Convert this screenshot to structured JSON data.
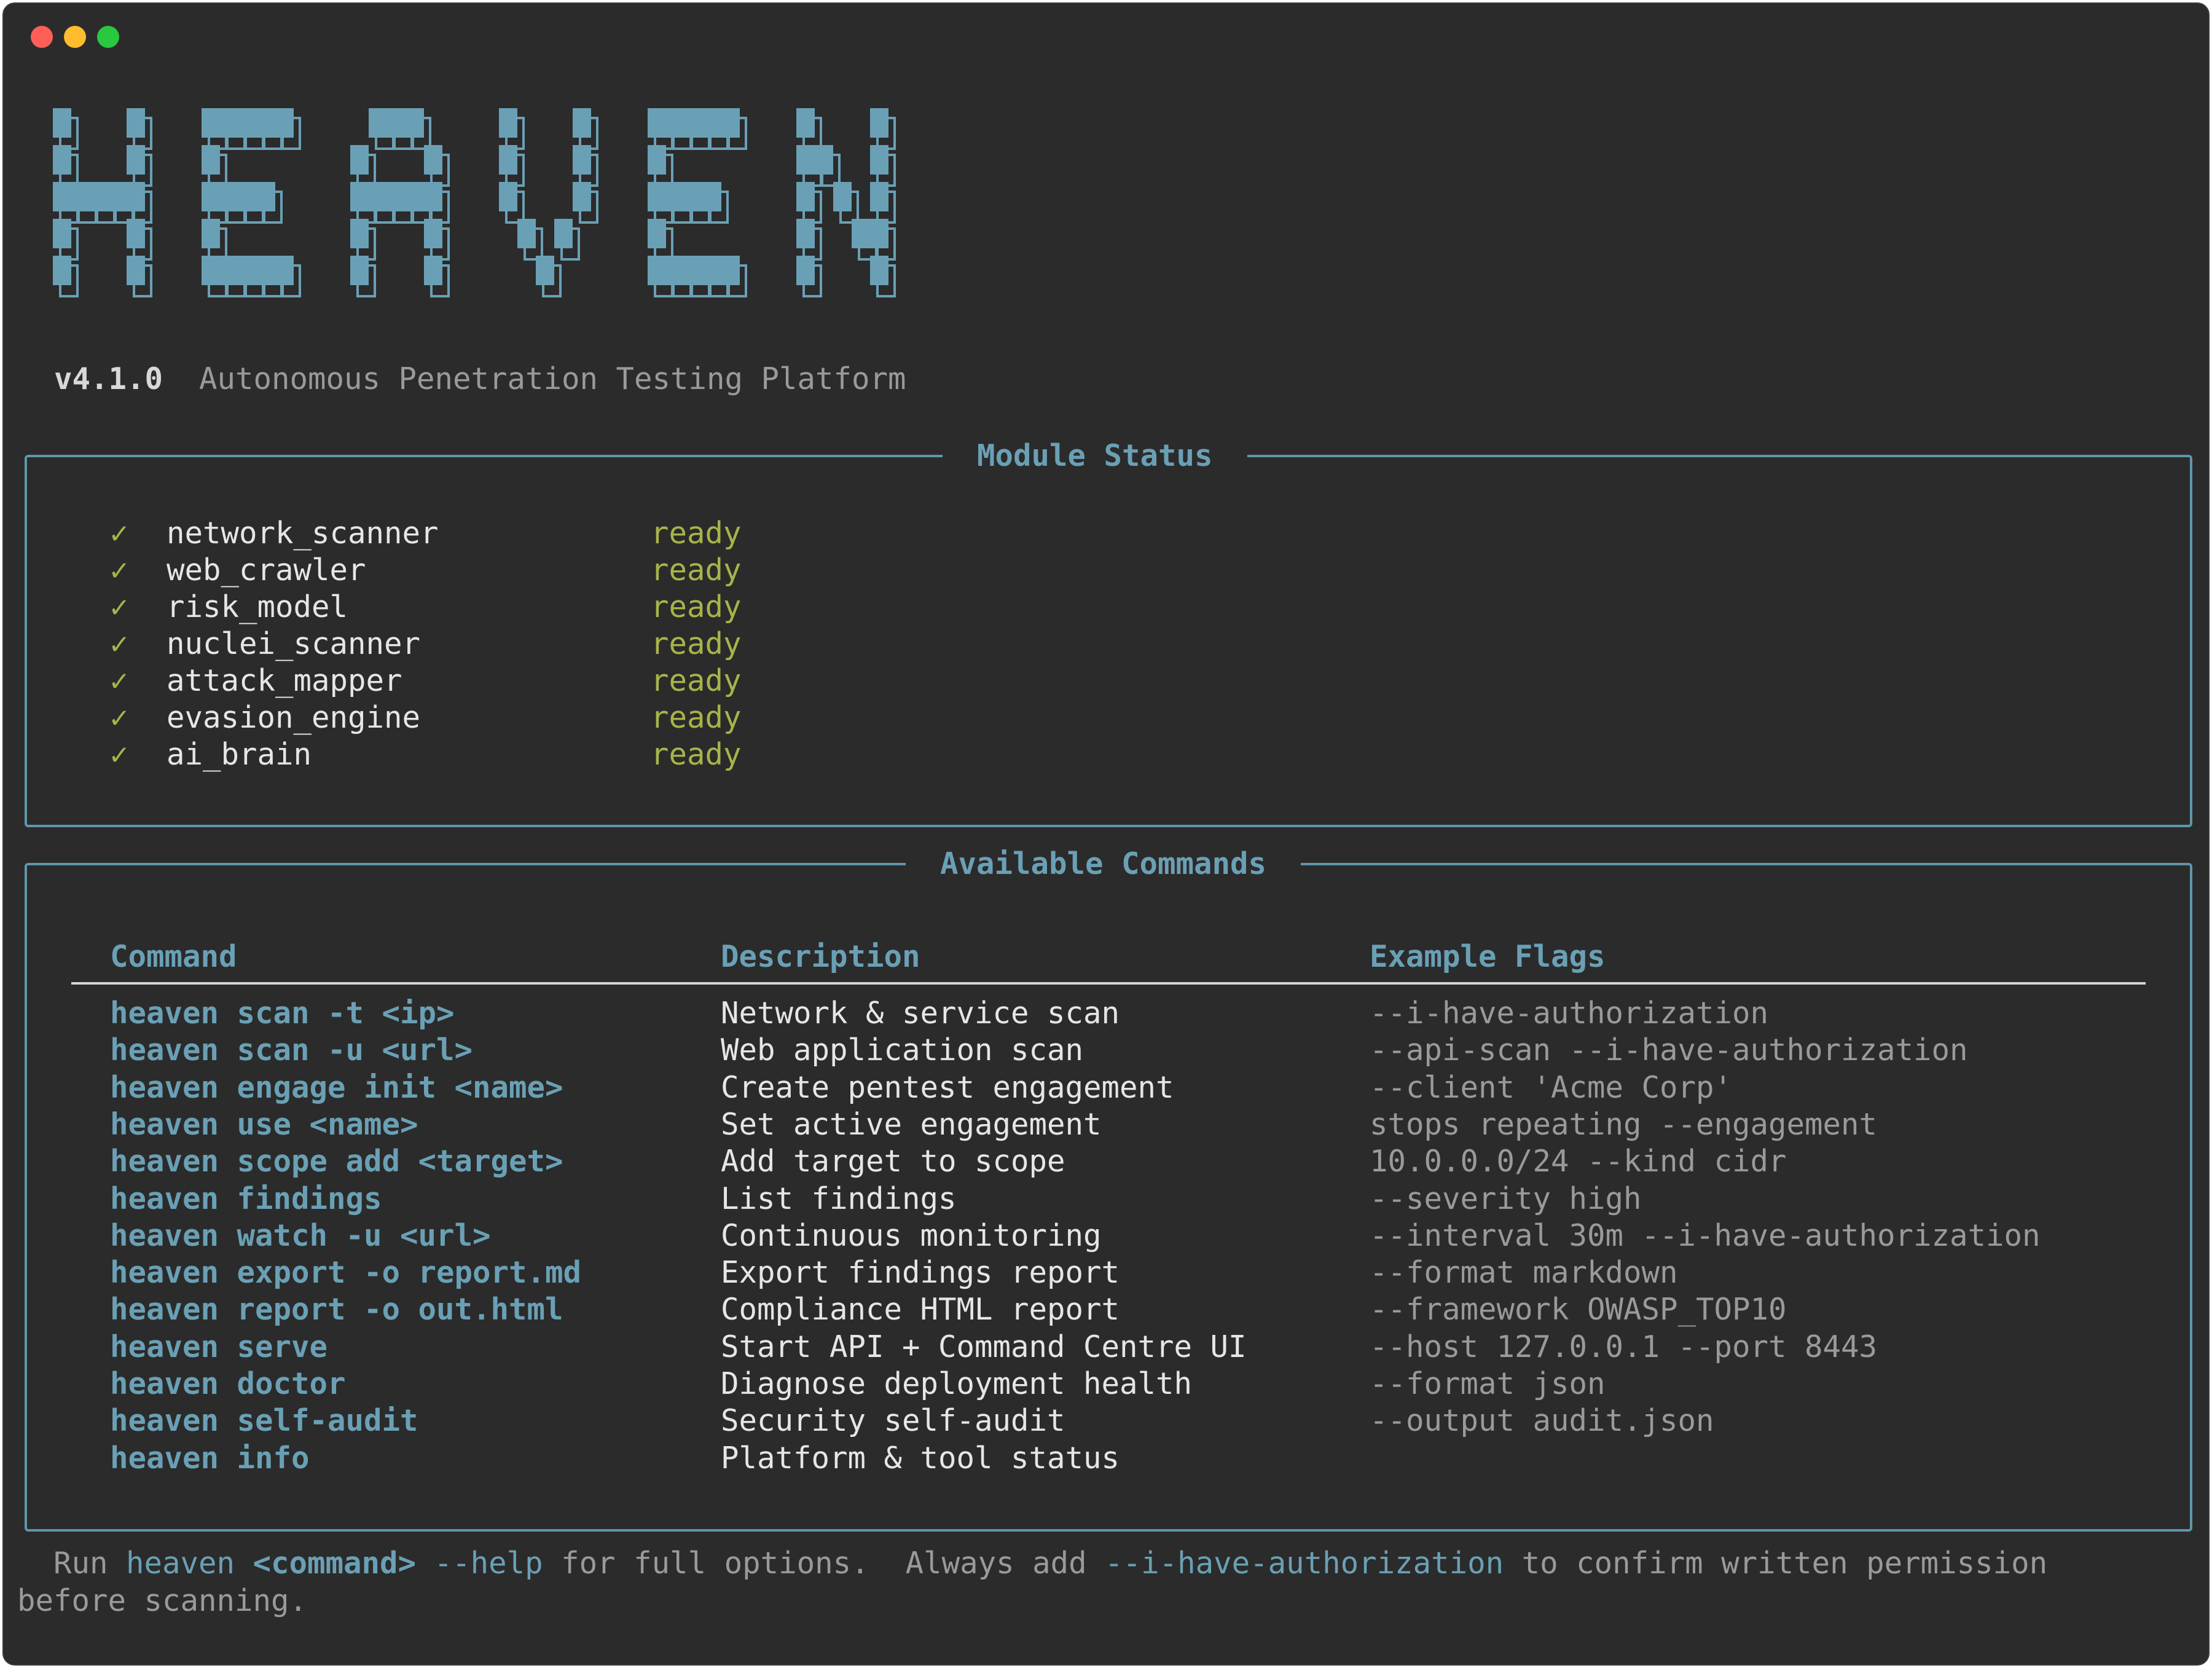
{
  "window": {
    "controls": [
      "close",
      "minimize",
      "maximize"
    ]
  },
  "banner": {
    "logo_text": "HEAVEN",
    "version": "v4.1.0",
    "tagline": "Autonomous Penetration Testing Platform"
  },
  "module_status": {
    "title": "Module Status",
    "check_icon": "✓",
    "modules": [
      {
        "name": "network_scanner",
        "status": "ready"
      },
      {
        "name": "web_crawler",
        "status": "ready"
      },
      {
        "name": "risk_model",
        "status": "ready"
      },
      {
        "name": "nuclei_scanner",
        "status": "ready"
      },
      {
        "name": "attack_mapper",
        "status": "ready"
      },
      {
        "name": "evasion_engine",
        "status": "ready"
      },
      {
        "name": "ai_brain",
        "status": "ready"
      }
    ]
  },
  "commands": {
    "title": "Available Commands",
    "headers": {
      "command": "Command",
      "description": "Description",
      "flags": "Example Flags"
    },
    "rows": [
      {
        "command": "heaven scan -t <ip>",
        "description": "Network & service scan",
        "flags": "--i-have-authorization"
      },
      {
        "command": "heaven scan -u <url>",
        "description": "Web application scan",
        "flags": "--api-scan --i-have-authorization"
      },
      {
        "command": "heaven engage init <name>",
        "description": "Create pentest engagement",
        "flags": "--client 'Acme Corp'"
      },
      {
        "command": "heaven use <name>",
        "description": "Set active engagement",
        "flags": "stops repeating --engagement"
      },
      {
        "command": "heaven scope add <target>",
        "description": "Add target to scope",
        "flags": "10.0.0.0/24 --kind cidr"
      },
      {
        "command": "heaven findings",
        "description": "List findings",
        "flags": "--severity high"
      },
      {
        "command": "heaven watch -u <url>",
        "description": "Continuous monitoring",
        "flags": "--interval 30m --i-have-authorization"
      },
      {
        "command": "heaven export -o report.md",
        "description": "Export findings report",
        "flags": "--format markdown"
      },
      {
        "command": "heaven report -o out.html",
        "description": "Compliance HTML report",
        "flags": "--framework OWASP_TOP10"
      },
      {
        "command": "heaven serve",
        "description": "Start API + Command Centre UI",
        "flags": "--host 127.0.0.1 --port 8443"
      },
      {
        "command": "heaven doctor",
        "description": "Diagnose deployment health",
        "flags": "--format json"
      },
      {
        "command": "heaven self-audit",
        "description": "Security self-audit",
        "flags": "--output audit.json"
      },
      {
        "command": "heaven info",
        "description": "Platform & tool status",
        "flags": ""
      }
    ]
  },
  "footer": {
    "run_prefix": "  Run ",
    "heaven": "heaven",
    "command_arg": "<command>",
    "help_flag": "--help",
    "middle": " for full options.  Always add ",
    "auth_flag": "--i-have-authorization",
    "suffix": " to confirm written permission\nbefore scanning."
  },
  "colors": {
    "background": "#2b2b2b",
    "accent": "#6aa0b5",
    "ready": "#a9b34a",
    "text": "#e6e6e6",
    "muted": "#9a9a9a"
  }
}
